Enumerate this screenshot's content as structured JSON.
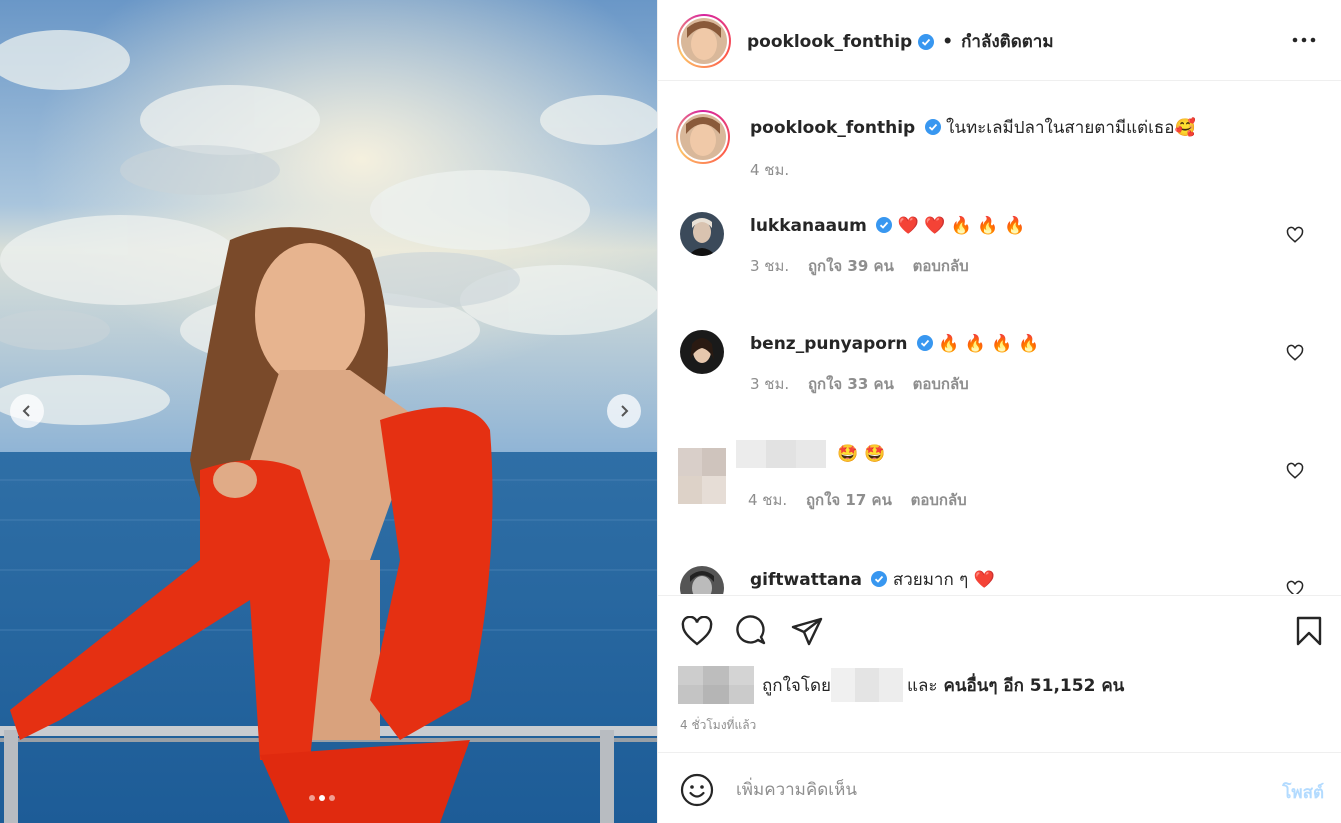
{
  "photo": {
    "alt_icon_prev": "chevron-left-icon",
    "alt_icon_next": "chevron-right-icon",
    "slide_count": 3,
    "active_slide": 2
  },
  "header": {
    "username": "pooklook_fonthip",
    "separator": "•",
    "follow_status": "กำลังติดตาม",
    "more_icon": "more-horizontal-icon"
  },
  "caption": {
    "username": "pooklook_fonthip",
    "text": "ในทะเลมีปลาในสายตามีแต่เธอ",
    "emoji": "🥰",
    "time": "4 ชม."
  },
  "comments": [
    {
      "username": "lukkanaaum",
      "verified": true,
      "text": "❤️ ❤️ 🔥 🔥 🔥",
      "time": "3 ชม.",
      "likes": "ถูกใจ 39 คน",
      "reply": "ตอบกลับ"
    },
    {
      "username": "benz_punyaporn",
      "verified": true,
      "text": "🔥 🔥 🔥 🔥",
      "time": "3 ชม.",
      "likes": "ถูกใจ 33 คน",
      "reply": "ตอบกลับ"
    },
    {
      "username": "",
      "verified": false,
      "text": "🤩 🤩",
      "time": "4 ชม.",
      "likes": "ถูกใจ 17 คน",
      "reply": "ตอบกลับ"
    },
    {
      "username": "giftwattana",
      "verified": true,
      "text": "สวยมาก ๆ ❤️",
      "time": "",
      "likes": "",
      "reply": ""
    }
  ],
  "actions": {
    "like_icon": "heart-icon",
    "comment_icon": "comment-icon",
    "share_icon": "send-icon",
    "save_icon": "bookmark-icon",
    "liked_by_prefix": "ถูกใจโดย",
    "liked_by_and": "และ",
    "liked_by_others": "คนอื่นๆ อีก 51,152 คน",
    "timestamp": "4 ชั่วโมงที่แล้ว"
  },
  "add_comment": {
    "emoji_icon": "smiley-icon",
    "placeholder": "เพิ่มความคิดเห็น",
    "post_label": "โพสต์"
  },
  "colors": {
    "verified_blue": "#3897f0",
    "post_disabled": "#b3dbff",
    "secondary_text": "#8e8e8e",
    "divider": "#efefef"
  }
}
